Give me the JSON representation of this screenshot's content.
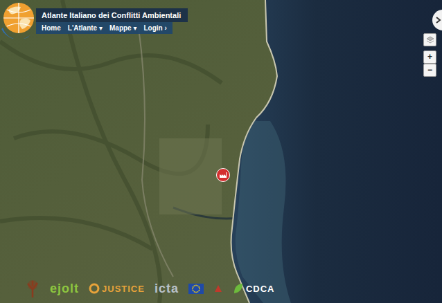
{
  "header": {
    "title": "Atlante Italiano dei Conflitti Ambientali",
    "nav": [
      {
        "label": "Home",
        "suffix": ""
      },
      {
        "label": "L'Atlante",
        "suffix": "▾"
      },
      {
        "label": "Mappe",
        "suffix": "▾"
      },
      {
        "label": "Login",
        "suffix": "›"
      }
    ]
  },
  "map_controls": {
    "zoom_in": "+",
    "zoom_out": "−"
  },
  "markers": [
    {
      "kind": "industry"
    }
  ],
  "footer_logos": [
    {
      "kind": "tree",
      "text": "",
      "color": "#8a3b1e"
    },
    {
      "kind": "wordmark",
      "text": "ejolt",
      "color": "#8dc63f"
    },
    {
      "kind": "justice",
      "text": "JUSTICE",
      "color": "#e8a33a"
    },
    {
      "kind": "wordmark",
      "text": "icta",
      "color": "#b9c1c9"
    },
    {
      "kind": "eu",
      "text": "",
      "color": "#1f4aa8"
    },
    {
      "kind": "mark",
      "text": "",
      "color": "#c0392b"
    },
    {
      "kind": "leaf",
      "text": "CDCA",
      "color": "#ffffff"
    }
  ]
}
